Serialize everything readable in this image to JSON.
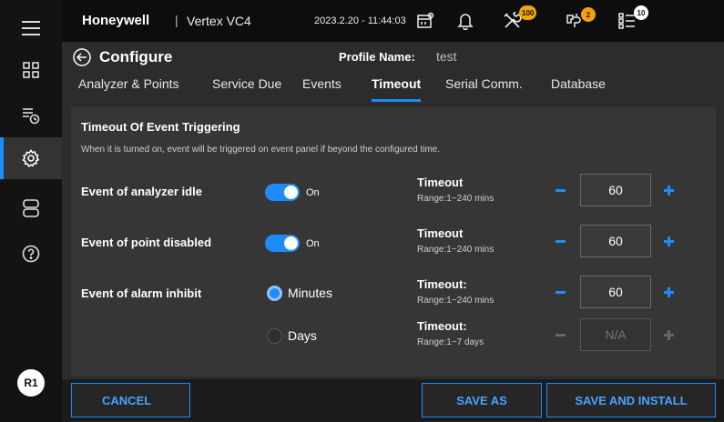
{
  "header": {
    "brand": "Honeywell",
    "separator": "|",
    "product": "Vertex VC4",
    "datetime": "2023.2.20 - 11:44:03",
    "tools_badge": "100",
    "maintenance_badge": "2",
    "list_badge": "10"
  },
  "sidebar": {
    "user_initials": "R1"
  },
  "page": {
    "title": "Configure",
    "profile_label": "Profile Name:",
    "profile_value": "test"
  },
  "tabs": [
    {
      "label": "Analyzer & Points"
    },
    {
      "label": "Service Due"
    },
    {
      "label": "Events"
    },
    {
      "label": "Timeout"
    },
    {
      "label": "Serial Comm."
    },
    {
      "label": "Database"
    }
  ],
  "section": {
    "title": "Timeout Of Event Triggering",
    "description": "When it is turned on, event will be triggered on event panel if beyond the configured time."
  },
  "rows": {
    "analyzer_idle": {
      "label": "Event of analyzer idle",
      "toggle": "On",
      "timeout_label": "Timeout",
      "range": "Range:1~240 mins",
      "value": "60"
    },
    "point_disabled": {
      "label": "Event of point disabled",
      "toggle": "On",
      "timeout_label": "Timeout",
      "range": "Range:1~240 mins",
      "value": "60"
    },
    "alarm_inhibit": {
      "label": "Event of alarm inhibit",
      "option_minutes": "Minutes",
      "option_days": "Days",
      "minutes_timeout_label": "Timeout:",
      "minutes_range": "Range:1~240 mins",
      "minutes_value": "60",
      "days_timeout_label": "Timeout:",
      "days_range": "Range:1~7 days",
      "days_value": "N/A"
    }
  },
  "footer": {
    "cancel": "CANCEL",
    "save_as": "SAVE AS",
    "save_and_install": "SAVE AND INSTALL"
  },
  "colors": {
    "accent": "#1d8cf8",
    "badge": "#f5a300"
  }
}
